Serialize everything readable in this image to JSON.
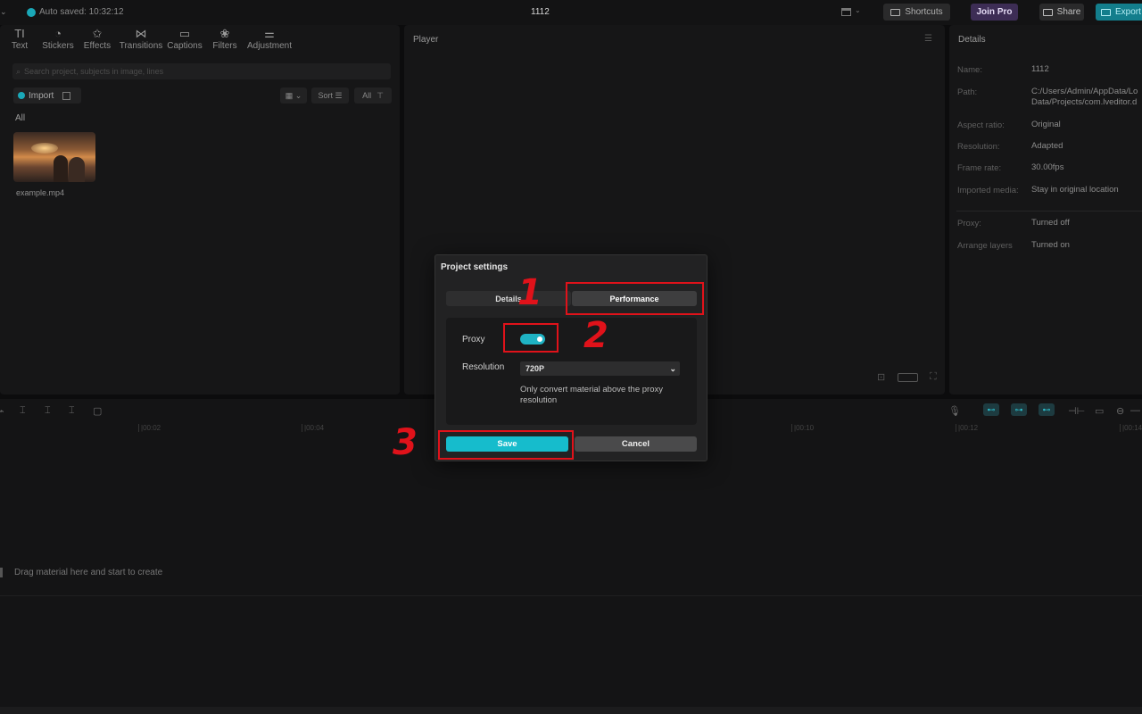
{
  "topbar": {
    "autosave": "Auto saved: 10:32:12",
    "project_title": "1112",
    "shortcuts_label": "Shortcuts",
    "joinpro_label": "Join Pro",
    "share_label": "Share",
    "export_label": "Export"
  },
  "toolbar": {
    "items": [
      {
        "icon": "TI",
        "label": "Text"
      },
      {
        "icon": "◔",
        "label": "Stickers"
      },
      {
        "icon": "✩",
        "label": "Effects"
      },
      {
        "icon": "⋈",
        "label": "Transitions"
      },
      {
        "icon": "▭",
        "label": "Captions"
      },
      {
        "icon": "❀",
        "label": "Filters"
      },
      {
        "icon": "⚌",
        "label": "Adjustment"
      }
    ]
  },
  "media": {
    "search_placeholder": "Search project, subjects in image, lines",
    "import_label": "Import",
    "sort_label": "Sort",
    "all_filter_label": "All",
    "all_section": "All",
    "file_name": "example.mp4"
  },
  "player": {
    "title": "Player"
  },
  "details": {
    "title": "Details",
    "rows": [
      {
        "label": "Name:",
        "value": "1112"
      },
      {
        "label": "Path:",
        "value": "C:/Users/Admin/AppData/Lo",
        "value2": "Data/Projects/com.lveditor.d"
      },
      {
        "label": "Aspect ratio:",
        "value": "Original"
      },
      {
        "label": "Resolution:",
        "value": "Adapted"
      },
      {
        "label": "Frame rate:",
        "value": "30.00fps"
      },
      {
        "label": "Imported media:",
        "value": "Stay in original location"
      },
      {
        "label": "Proxy:",
        "value": "Turned off"
      },
      {
        "label": "Arrange layers",
        "value": "Turned on"
      }
    ]
  },
  "timeline": {
    "ticks": [
      "|00:02",
      "|00:04",
      "|00:10",
      "|00:12",
      "|00:14"
    ],
    "drag_hint": "Drag material here and start to create"
  },
  "dialog": {
    "title": "Project settings",
    "tab_details": "Details",
    "tab_performance": "Performance",
    "proxy_label": "Proxy",
    "proxy_on": true,
    "resolution_label": "Resolution",
    "resolution_value": "720P",
    "resolution_note": "Only convert material above the proxy resolution",
    "save_label": "Save",
    "cancel_label": "Cancel"
  },
  "annotations": {
    "step1": "1",
    "step2": "2",
    "step3": "3",
    "color": "#e0121a"
  },
  "colors": {
    "accent": "#16bccc",
    "pro": "#3d2d55",
    "background": "#0c0c0d"
  }
}
